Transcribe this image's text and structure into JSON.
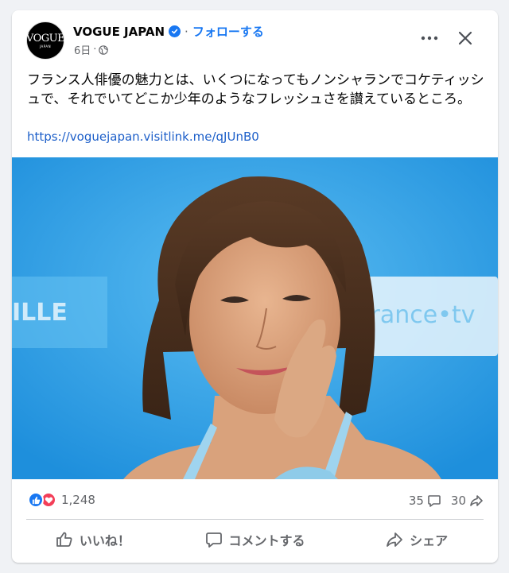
{
  "post": {
    "author": "VOGUE JAPAN",
    "follow_label": "フォローする",
    "separator": "·",
    "time": "6日",
    "time_separator": "·",
    "avatar_logo": "VOGUE",
    "avatar_sub": "JAPAN",
    "text": "フランス人俳優の魅力とは、いくつになってもノンシャランでコケティッシュで、それでいてどこか少年のようなフレッシュさを讃えているところ。",
    "link": "https://voguejapan.visitlink.me/qJUnB0",
    "more_label": "•••"
  },
  "photo": {
    "backdrop_text_left": "ILLE",
    "backdrop_text_right": "france•tv"
  },
  "stats": {
    "reaction_count": "1,248",
    "comment_count": "35",
    "share_count": "30"
  },
  "actions": {
    "like_label": "いいね！",
    "comment_label": "コメントする",
    "share_label": "シェア"
  },
  "colors": {
    "accent": "#1877f2",
    "link": "#1d5fc9",
    "muted": "#65676b",
    "love": "#f33e58",
    "photo_background": "#35a6ea"
  }
}
